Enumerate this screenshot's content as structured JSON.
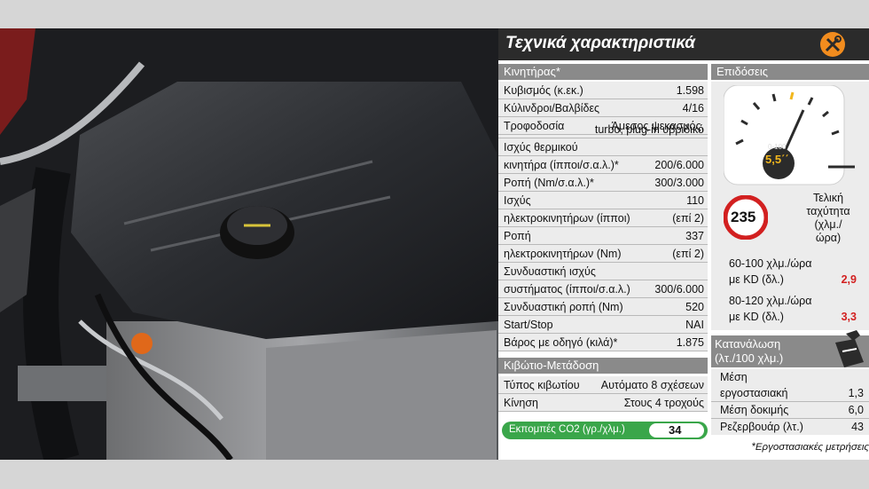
{
  "title": "Τεχνικά χαρακτηριστικά",
  "engine": {
    "header": "Κινητήρας*",
    "rows": [
      {
        "label": "Κυβισμός (κ.εκ.)",
        "value": "1.598"
      },
      {
        "label": "Κύλινδροι/Βαλβίδες",
        "value": "4/16"
      },
      {
        "label": "Τροφοδοσία",
        "value": "Άμεσος ψεκασμός,"
      },
      {
        "label": "",
        "value": "turbo, plug-in υβριδικό"
      },
      {
        "label": "Ισχύς θερμικού",
        "value": ""
      },
      {
        "label": "κινητήρα (ίπποι/σ.α.λ.)*",
        "value": "200/6.000"
      },
      {
        "label": "Ροπή (Nm/σ.α.λ.)*",
        "value": "300/3.000"
      },
      {
        "label": "Ισχύς",
        "value": "110"
      },
      {
        "label": "ηλεκτροκινητήρων (ίπποι)",
        "value": "(επί 2)"
      },
      {
        "label": "Ροπή",
        "value": "337"
      },
      {
        "label": "ηλεκτροκινητήρων (Nm)",
        "value": "(επί 2)"
      },
      {
        "label": "Συνδυαστική ισχύς",
        "value": ""
      },
      {
        "label": "συστήματος (ίπποι/σ.α.λ.)",
        "value": "300/6.000"
      },
      {
        "label": "Συνδυαστική ροπή (Nm)",
        "value": "520"
      },
      {
        "label": "Start/Stop",
        "value": "ΝΑΙ"
      },
      {
        "label": "Βάρος με οδηγό (κιλά)*",
        "value": "1.875"
      }
    ]
  },
  "gearbox": {
    "header": "Κιβώτιο-Μετάδοση",
    "rows": [
      {
        "label": "Τύπος κιβωτίου",
        "value": "Αυτόματο 8 σχέσεων"
      },
      {
        "label": "Κίνηση",
        "value": "Στους 4 τροχούς"
      }
    ]
  },
  "co2": {
    "label": "Εκπομπές CO2 (γρ./χλμ.)",
    "value": "34"
  },
  "performance": {
    "header": "Επιδόσεις",
    "gauge_label": "0-100",
    "gauge_value": "5,5΄΄",
    "top_speed": "235",
    "top_speed_label_1": "Τελική",
    "top_speed_label_2": "ταχύτητα",
    "top_speed_label_3": "(χλμ./",
    "top_speed_label_4": "ώρα)",
    "accel1_line1": "60-100 χλμ./ώρα",
    "accel1_line2": "με KD (δλ.)",
    "accel1_value": "2,9",
    "accel2_line1": "80-120 χλμ./ώρα",
    "accel2_line2": "με KD (δλ.)",
    "accel2_value": "3,3"
  },
  "consumption": {
    "header_1": "Κατανάλωση",
    "header_2": "(λτ./100 χλμ.)",
    "row1_line1": "Μέση",
    "row1_line2": "εργοστασιακή",
    "row1_value": "1,3",
    "row2_label": "Μέση δοκιμής",
    "row2_value": "6,0",
    "row3_label": "Ρεζερβουάρ (λτ.)",
    "row3_value": "43"
  },
  "footnote": "*Εργοστασιακές μετρήσεις",
  "colors": {
    "accent": "#f28c1e",
    "green": "#3aa64a",
    "red": "#d22020",
    "header_gray": "#8a8a8a"
  }
}
